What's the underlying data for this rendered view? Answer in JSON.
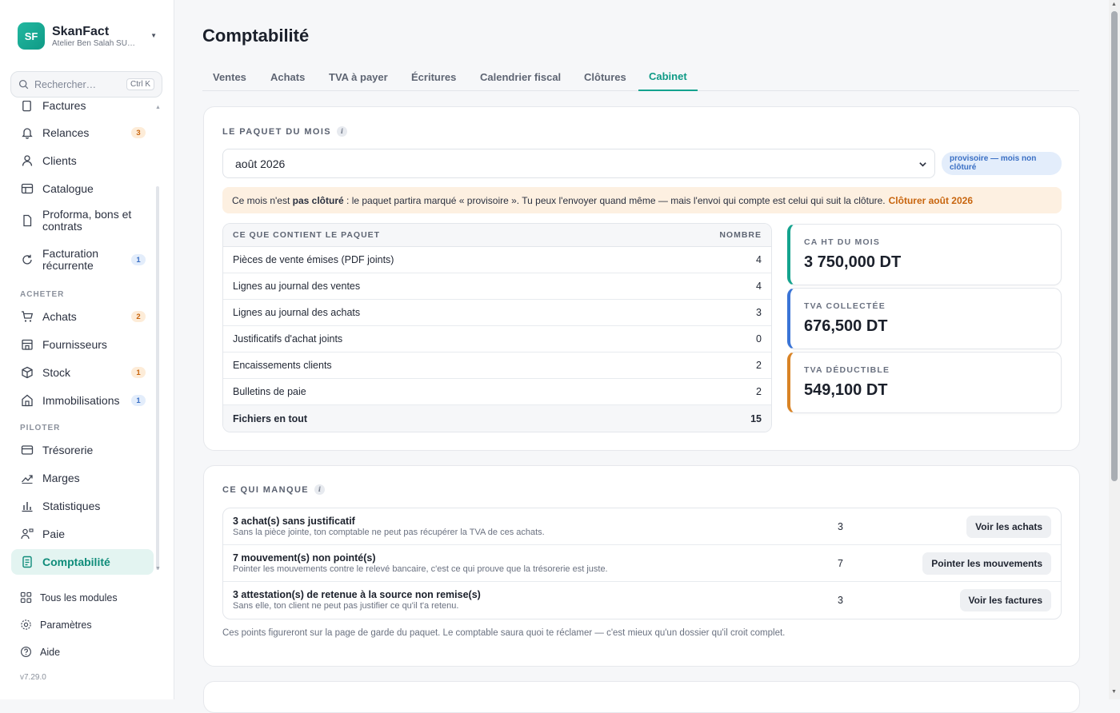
{
  "brand": {
    "initials": "SF",
    "name": "SkanFact",
    "company": "Atelier Ben Salah SU…"
  },
  "search": {
    "placeholder": "Rechercher…",
    "shortcut": "Ctrl K"
  },
  "sidebar": {
    "partial_item": "Factures",
    "items_top": [
      {
        "label": "Relances",
        "icon": "bell-icon",
        "badge": "3",
        "badge_color": "orange"
      },
      {
        "label": "Clients",
        "icon": "user-icon"
      },
      {
        "label": "Catalogue",
        "icon": "table-icon"
      },
      {
        "label": "Proforma, bons et contrats",
        "icon": "document-icon"
      },
      {
        "label": "Facturation récurrente",
        "icon": "refresh-icon",
        "badge": "1",
        "badge_color": "blue"
      }
    ],
    "section_acheter": "ACHETER",
    "items_acheter": [
      {
        "label": "Achats",
        "icon": "cart-icon",
        "badge": "2",
        "badge_color": "orange"
      },
      {
        "label": "Fournisseurs",
        "icon": "store-icon"
      },
      {
        "label": "Stock",
        "icon": "box-icon",
        "badge": "1",
        "badge_color": "orange"
      },
      {
        "label": "Immobilisations",
        "icon": "building-icon",
        "badge": "1",
        "badge_color": "blue"
      }
    ],
    "section_piloter": "PILOTER",
    "items_piloter": [
      {
        "label": "Trésorerie",
        "icon": "wallet-icon"
      },
      {
        "label": "Marges",
        "icon": "trend-icon"
      },
      {
        "label": "Statistiques",
        "icon": "bar-chart-icon"
      },
      {
        "label": "Paie",
        "icon": "people-icon"
      },
      {
        "label": "Comptabilité",
        "icon": "ledger-icon",
        "active": true
      }
    ],
    "footer": [
      {
        "label": "Tous les modules",
        "icon": "grid-icon"
      },
      {
        "label": "Paramètres",
        "icon": "gear-icon"
      },
      {
        "label": "Aide",
        "icon": "help-icon"
      }
    ],
    "version": "v7.29.0"
  },
  "page": {
    "title": "Comptabilité"
  },
  "tabs": [
    "Ventes",
    "Achats",
    "TVA à payer",
    "Écritures",
    "Calendrier fiscal",
    "Clôtures",
    "Cabinet"
  ],
  "active_tab": "Cabinet",
  "paquet": {
    "title": "LE PAQUET DU MOIS",
    "month": "août 2026",
    "status_badge": "provisoire — mois non clôturé",
    "alert_pre": "Ce mois n'est ",
    "alert_bold": "pas clôturé",
    "alert_post": " : le paquet partira marqué « provisoire ». Tu peux l'envoyer quand même — mais l'envoi qui compte est celui qui suit la clôture.",
    "alert_link": "Clôturer août 2026",
    "table_header": {
      "label": "CE QUE CONTIENT LE PAQUET",
      "count": "NOMBRE"
    },
    "rows": [
      {
        "label": "Pièces de vente émises (PDF joints)",
        "count": "4"
      },
      {
        "label": "Lignes au journal des ventes",
        "count": "4"
      },
      {
        "label": "Lignes au journal des achats",
        "count": "3"
      },
      {
        "label": "Justificatifs d'achat joints",
        "count": "0"
      },
      {
        "label": "Encaissements clients",
        "count": "2"
      },
      {
        "label": "Bulletins de paie",
        "count": "2"
      }
    ],
    "total": {
      "label": "Fichiers en tout",
      "count": "15"
    },
    "kpis": [
      {
        "label": "CA HT DU MOIS",
        "value": "3 750,000 DT",
        "color": "#14a38e"
      },
      {
        "label": "TVA COLLECTÉE",
        "value": "676,500 DT",
        "color": "#3a74d6"
      },
      {
        "label": "TVA DÉDUCTIBLE",
        "value": "549,100 DT",
        "color": "#d98325"
      }
    ]
  },
  "missing": {
    "title": "CE QUI MANQUE",
    "rows": [
      {
        "title": "3 achat(s) sans justificatif",
        "desc": "Sans la pièce jointe, ton comptable ne peut pas récupérer la TVA de ces achats.",
        "count": "3",
        "button": "Voir les achats"
      },
      {
        "title": "7 mouvement(s) non pointé(s)",
        "desc": "Pointer les mouvements contre le relevé bancaire, c'est ce qui prouve que la trésorerie est juste.",
        "count": "7",
        "button": "Pointer les mouvements"
      },
      {
        "title": "3 attestation(s) de retenue à la source non remise(s)",
        "desc": "Sans elle, ton client ne peut pas justifier ce qu'il t'a retenu.",
        "count": "3",
        "button": "Voir les factures"
      }
    ],
    "note": "Ces points figureront sur la page de garde du paquet. Le comptable saura quoi te réclamer — c'est mieux qu'un dossier qu'il croit complet."
  }
}
